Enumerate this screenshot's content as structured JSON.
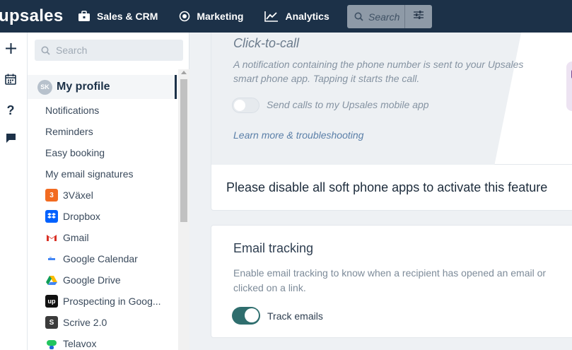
{
  "topbar": {
    "logo": "upsales",
    "nav": [
      {
        "label": "Sales & CRM",
        "icon": "briefcase-icon"
      },
      {
        "label": "Marketing",
        "icon": "target-icon"
      },
      {
        "label": "Analytics",
        "icon": "chart-line-icon"
      }
    ],
    "search_placeholder": "Search"
  },
  "rail": {
    "icons": [
      "plus-icon",
      "calendar-icon",
      "help-icon",
      "chat-icon"
    ]
  },
  "sidebar": {
    "search_placeholder": "Search",
    "profile": {
      "initials": "SK",
      "name": "My profile"
    },
    "menu": [
      "Notifications",
      "Reminders",
      "Easy booking",
      "My email signatures"
    ],
    "integrations": [
      {
        "label": "3Växel",
        "icon": "3vaxel-icon",
        "color": "#f26b21",
        "glyph": "3"
      },
      {
        "label": "Dropbox",
        "icon": "dropbox-icon",
        "color": "#0061fe",
        "glyph": "◆"
      },
      {
        "label": "Gmail",
        "icon": "gmail-icon",
        "color": "#ffffff",
        "glyph": "M"
      },
      {
        "label": "Google Calendar",
        "icon": "google-calendar-icon",
        "color": "#ffffff",
        "glyph": "▬"
      },
      {
        "label": "Google Drive",
        "icon": "google-drive-icon",
        "color": "#ffffff",
        "glyph": "▲"
      },
      {
        "label": "Prospecting in Goog...",
        "icon": "prospecting-icon",
        "color": "#111111",
        "glyph": "up"
      },
      {
        "label": "Scrive 2.0",
        "icon": "scrive-icon",
        "color": "#3b3b3b",
        "glyph": "S"
      },
      {
        "label": "Telavox",
        "icon": "telavox-icon",
        "color": "#ffffff",
        "glyph": "●"
      }
    ]
  },
  "click_to_call": {
    "title": "Click-to-call",
    "description": "A notification containing the phone number is sent to your Upsales smart phone app. Tapping it starts the call.",
    "toggle_label": "Send calls to my Upsales mobile app",
    "toggle_on": false,
    "link": "Learn more & troubleshooting"
  },
  "banner": {
    "text": "Please disable all soft phone apps to activate this feature"
  },
  "email_tracking": {
    "title": "Email tracking",
    "description": "Enable email tracking to know when a recipient has opened an email or clicked on a link.",
    "toggle_label": "Track emails",
    "toggle_on": true
  },
  "colors": {
    "topbar": "#1c3148",
    "accent_toggle": "#2f6e6e",
    "link": "#5a7fa8"
  }
}
